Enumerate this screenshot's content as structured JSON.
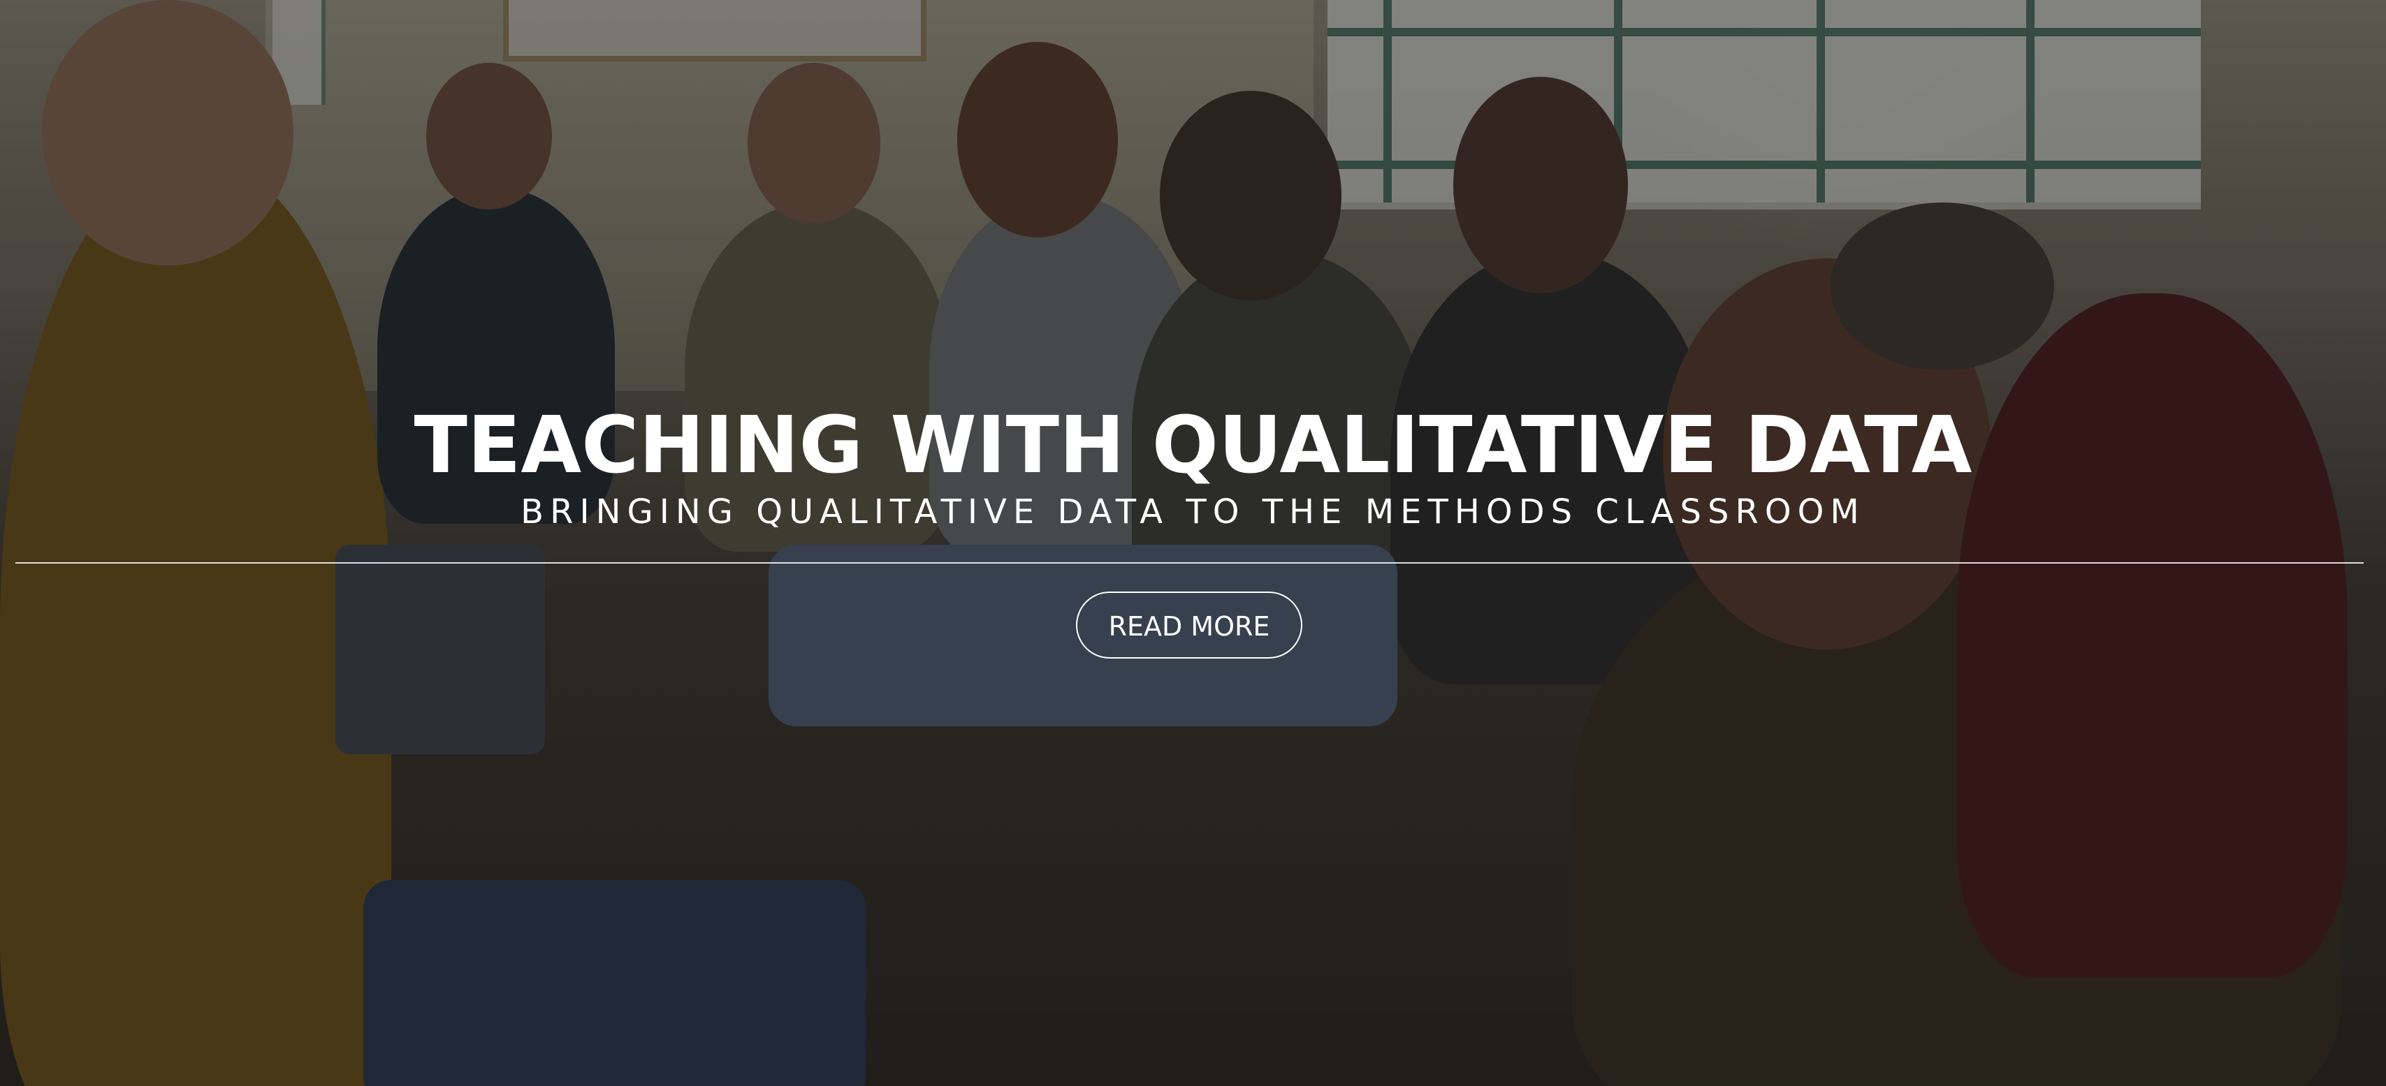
{
  "hero": {
    "title": "TEACHING WITH QUALITATIVE DATA",
    "subtitle": "BRINGING QUALITATIVE DATA TO THE METHODS CLASSROOM",
    "cta_label": "READ MORE"
  },
  "colors": {
    "text": "#ffffff",
    "overlay": "rgba(20,18,16,0.42)",
    "window_frame": "#3c6e64"
  }
}
